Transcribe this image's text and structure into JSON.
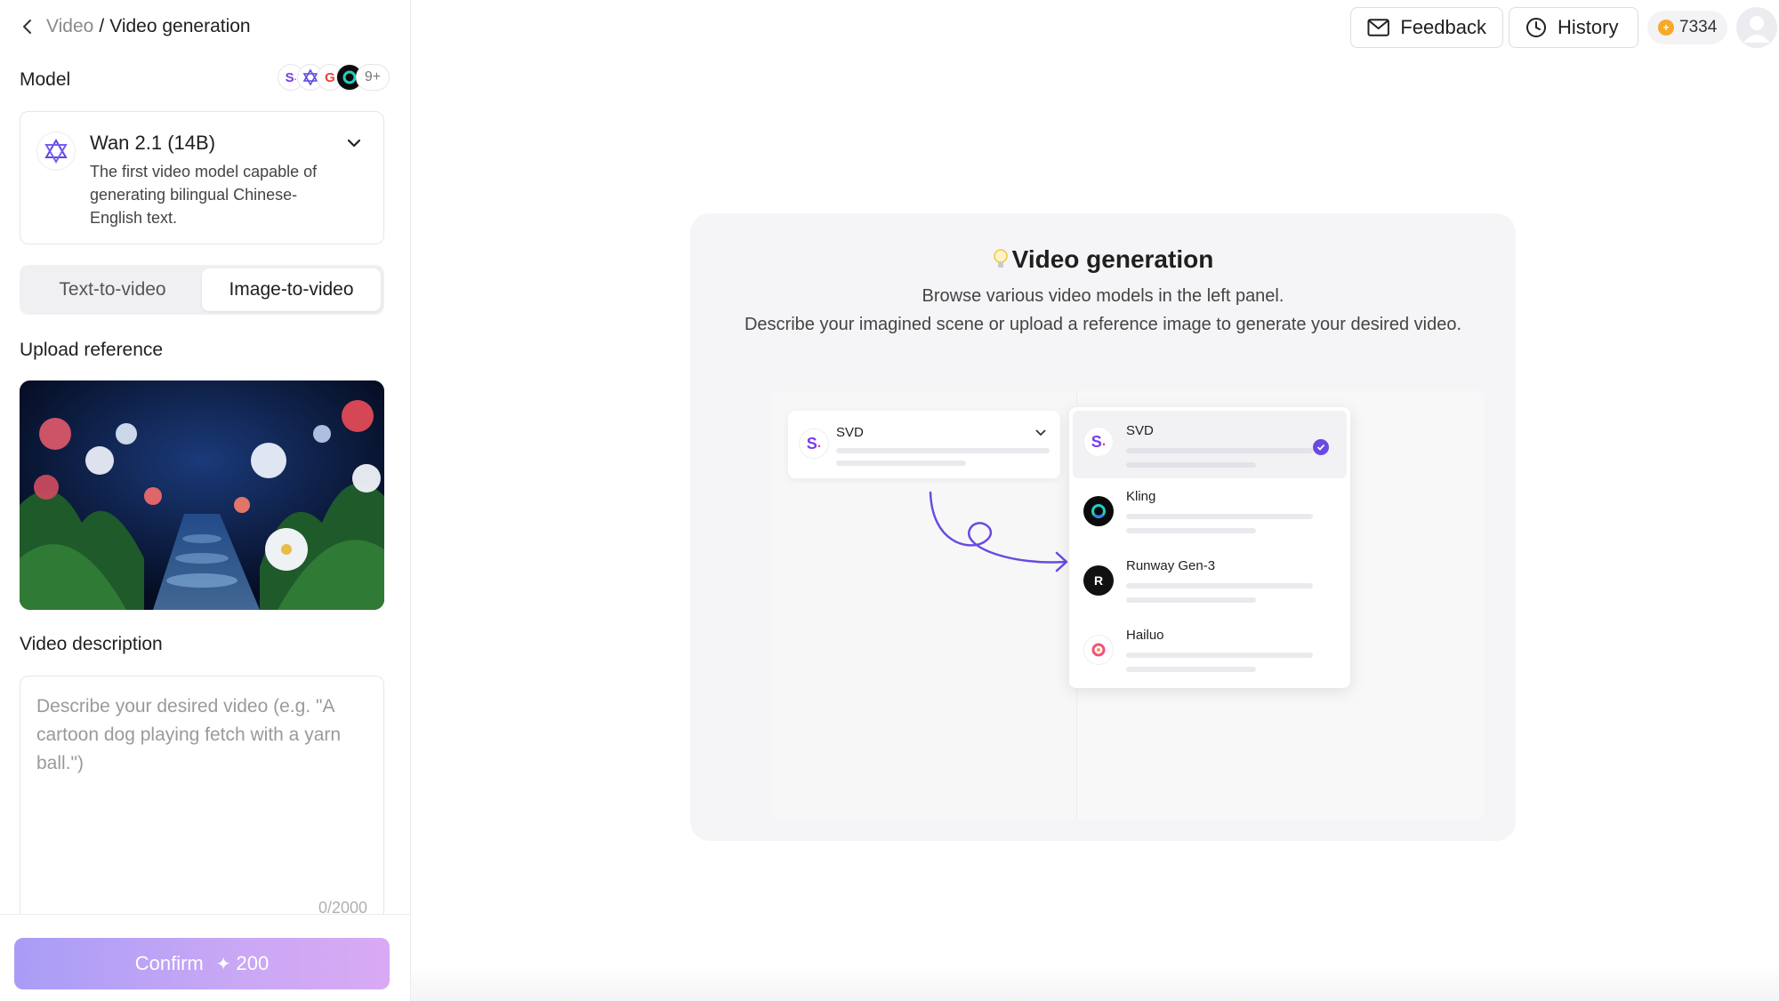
{
  "breadcrumb": {
    "root": "Video",
    "separator": "/",
    "current": "Video generation"
  },
  "model": {
    "section_label": "Model",
    "more_count": "9+",
    "selected_name": "Wan 2.1 (14B)",
    "selected_desc": "The first video model capable of generating bilingual Chinese-English text."
  },
  "mode_tabs": {
    "text_to_video": "Text-to-video",
    "image_to_video": "Image-to-video",
    "active": "image_to_video"
  },
  "upload": {
    "label": "Upload reference"
  },
  "description": {
    "label": "Video description",
    "placeholder": "Describe your desired video (e.g. \"A cartoon dog playing fetch with a yarn ball.\")",
    "counter": "0/2000"
  },
  "confirm": {
    "label": "Confirm",
    "cost": "200"
  },
  "topbar": {
    "feedback": "Feedback",
    "history": "History",
    "credits": "7334"
  },
  "guide": {
    "title": "Video generation",
    "line1": "Browse various video models in the left panel.",
    "line2": "Describe your imagined scene or upload a reference image to generate your desired video.",
    "select_value": "SVD",
    "options": [
      "SVD",
      "Kling",
      "Runway Gen-3",
      "Hailuo"
    ]
  },
  "colors": {
    "accent": "#6a4ae0",
    "confirm_gradient_start": "#a99cf6",
    "confirm_gradient_end": "#d9a9f4",
    "coin": "#f7a928"
  }
}
